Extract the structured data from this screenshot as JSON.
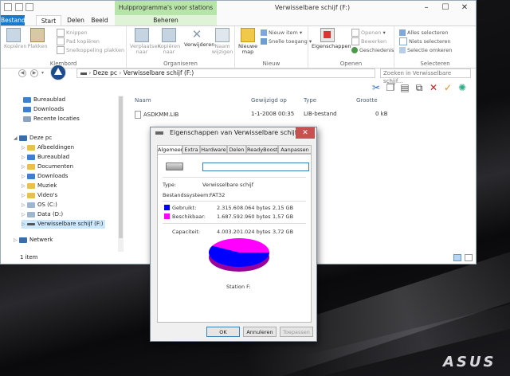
{
  "window": {
    "title": "Verwisselbare schijf (F:)",
    "contextual_group": "Hulpprogramma's voor stations",
    "minimize": "–",
    "maximize": "☐",
    "close": "✕"
  },
  "tabs": [
    "Bestand",
    "Start",
    "Delen",
    "Beeld",
    "Beheren"
  ],
  "ribbon": {
    "groups": [
      "Klembord",
      "Organiseren",
      "Nieuw",
      "Openen",
      "Selecteren"
    ],
    "kopieren": "Kopiëren",
    "plakken": "Plakken",
    "knippen": "Knippen",
    "pad_kopieren": "Pad kopiëren",
    "snelkoppeling_plakken": "Snelkoppeling plakken",
    "verplaatsen_naar": "Verplaatsen naar",
    "kopieren_naar": "Kopiëren naar",
    "verwijderen": "Verwijderen",
    "naam_wijzigen": "Naam wijzigen",
    "nieuwe_map": "Nieuwe map",
    "nieuw_item": "Nieuw item",
    "snelle_toegang": "Snelle toegang",
    "eigenschappen": "Eigenschappen",
    "openen": "Openen",
    "bewerken": "Bewerken",
    "geschiedenis": "Geschiedenis",
    "alles_selecteren": "Alles selecteren",
    "niets_selecteren": "Niets selecteren",
    "selectie_omkeren": "Selectie omkeren"
  },
  "address": {
    "path_1": "Deze pc",
    "path_2": "Verwisselbare schijf (F:)",
    "search_placeholder": "Zoeken in Verwisselbare schijf..."
  },
  "nav": {
    "favorites": [
      "Bureaublad",
      "Downloads",
      "Recente locaties"
    ],
    "this_pc": "Deze pc",
    "pc_items": [
      "Afbeeldingen",
      "Bureaublad",
      "Documenten",
      "Downloads",
      "Muziek",
      "Video's",
      "OS (C:)",
      "Data (D:)",
      "Verwisselbare schijf (F:)"
    ],
    "network": "Netwerk"
  },
  "files": {
    "columns": [
      "Naam",
      "Gewijzigd op",
      "Type",
      "Grootte"
    ],
    "rows": [
      {
        "name": "ASDKMM.LIB",
        "modified": "1-1-2008 00:35",
        "type": "LIB-bestand",
        "size": "0 kB"
      }
    ]
  },
  "status": {
    "count": "1 item"
  },
  "dialog": {
    "title": "Eigenschappen van Verwisselbare schijf (F:)",
    "tabs": [
      "Algemeen",
      "Extra",
      "Hardware",
      "Delen",
      "ReadyBoost",
      "Aanpassen"
    ],
    "name_value": "",
    "type_label": "Type:",
    "type_value": "Verwisselbare schijf",
    "fs_label": "Bestandssysteem:",
    "fs_value": "FAT32",
    "used_label": "Gebruikt:",
    "used_bytes": "2.315.608.064 bytes",
    "used_size": "2,15 GB",
    "free_label": "Beschikbaar:",
    "free_bytes": "1.687.592.960 bytes",
    "free_size": "1,57 GB",
    "capacity_label": "Capaciteit:",
    "capacity_bytes": "4.003.201.024 bytes",
    "capacity_size": "3,72 GB",
    "drive_caption": "Station F:",
    "used_color": "#0000ff",
    "free_color": "#ff00ff",
    "used_fraction": 0.578,
    "ok": "OK",
    "cancel": "Annuleren",
    "apply": "Toepassen"
  },
  "brand": {
    "logo": "ASUS"
  }
}
